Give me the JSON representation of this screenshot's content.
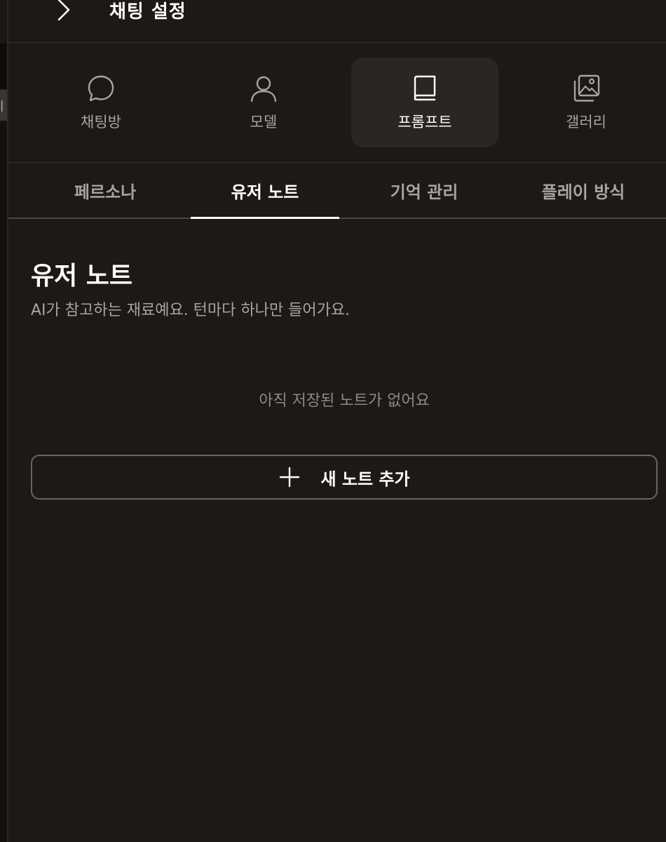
{
  "left_edge": {
    "tag_text": "|("
  },
  "header": {
    "title": "채팅 설정",
    "back_icon": "chevron-right-icon"
  },
  "nav": {
    "items": [
      {
        "label": "채팅방",
        "icon": "chat-bubble-icon",
        "active": false
      },
      {
        "label": "모델",
        "icon": "user-icon",
        "active": false
      },
      {
        "label": "프롬프트",
        "icon": "book-icon",
        "active": true
      },
      {
        "label": "갤러리",
        "icon": "gallery-icon",
        "active": false
      }
    ]
  },
  "tabs": {
    "items": [
      {
        "label": "페르소나",
        "active": false
      },
      {
        "label": "유저 노트",
        "active": true
      },
      {
        "label": "기억 관리",
        "active": false
      },
      {
        "label": "플레이 방식",
        "active": false
      }
    ]
  },
  "content": {
    "title": "유저 노트",
    "description": "AI가 참고하는 재료예요. 턴마다 하나만 들어가요.",
    "empty_message": "아직 저장된 노트가 없어요",
    "add_button_label": "새 노트 추가",
    "add_button_icon": "plus-icon"
  },
  "colors": {
    "background": "#1c1916",
    "active_nav_bg": "#2a2623",
    "text_primary": "#ffffff",
    "text_secondary": "#aaa49d",
    "border": "#6b655f"
  }
}
